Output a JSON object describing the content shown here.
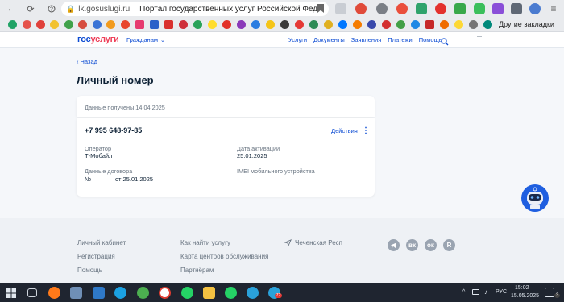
{
  "browser": {
    "nav": {
      "back": "←",
      "reload": "⟳"
    },
    "url": "lk.gosuslugi.ru",
    "tab_title": "Портал государственных услуг Российской Фед...",
    "other_bookmarks_label": "Другие закладки",
    "menu_glyph": "≡"
  },
  "header": {
    "logo_gos": "гос",
    "logo_uslugi": "услуги",
    "audience_label": "Гражданам",
    "nav": [
      "Услуги",
      "Документы",
      "Заявления",
      "Платежи",
      "Помощь"
    ]
  },
  "page": {
    "back_label": "Назад",
    "title": "Личный номер",
    "data_received": "Данные получены 14.04.2025"
  },
  "phone": {
    "number": "+7 995 648-97-85",
    "actions_label": "Действия",
    "operator_label": "Оператор",
    "operator_value": "Т-Мобайл",
    "activation_label": "Дата активации",
    "activation_value": "25.01.2025",
    "contract_label": "Данные договора",
    "contract_number_prefix": "№",
    "contract_date": "от 25.01.2025",
    "imei_label": "IMEI мобильного устройства",
    "imei_value": "—"
  },
  "footer": {
    "col1": [
      "Личный кабинет",
      "Регистрация",
      "Помощь"
    ],
    "col2": [
      "Как найти услугу",
      "Карта центров обслуживания",
      "Партнёрам"
    ],
    "region": "Чеченская Респ",
    "social": [
      "telegram",
      "vk",
      "ok",
      "rutube"
    ],
    "social_glyphs": {
      "vk": "вк",
      "ok": "ок",
      "rutube": "R"
    }
  },
  "taskbar": {
    "time": "15:02",
    "date": "15.05.2025",
    "lang": "РУС",
    "badge": "72",
    "notif_count": "3"
  },
  "colors": {
    "brand_blue": "#0d4cd3",
    "brand_red": "#ee3f58",
    "text_dark": "#0b1f33",
    "text_gray": "#66727f",
    "bg": "#f5f7fa"
  }
}
